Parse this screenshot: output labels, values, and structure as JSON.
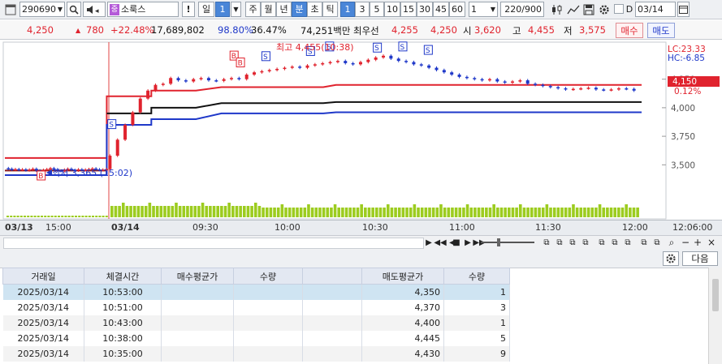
{
  "toolbar": {
    "code": "290690",
    "name": "소룩스",
    "period_day": "일",
    "period_num": "1",
    "periods": [
      "주",
      "월",
      "년",
      "분",
      "초",
      "틱"
    ],
    "intervals": [
      "1",
      "3",
      "5",
      "10",
      "15",
      "30",
      "45",
      "60"
    ],
    "count_select": "1",
    "count_display": "220/900",
    "date": "03/14",
    "d_label": "D",
    "excl": "!"
  },
  "quote": {
    "price": "4,250",
    "change": "780",
    "change_pct": "+22.48%",
    "volume": "17,689,802",
    "ratio1": "98.80%",
    "ratio2": "36.47%",
    "amount": "74,251백만",
    "best_ask_label": "최우선",
    "best_ask": "4,255",
    "best_bid": "4,250",
    "open_label": "시",
    "open": "3,620",
    "high_label": "고",
    "high": "4,455",
    "low_label": "저",
    "low": "3,575",
    "buy_button": "매수",
    "sell_button": "매도"
  },
  "chart_data": {
    "type": "candlestick",
    "yticks": [
      "4,250",
      "4,000",
      "3,750",
      "3,500"
    ],
    "ylim": [
      3275,
      4560
    ],
    "xticks": [
      "03/13",
      "15:00",
      "03/14",
      "09:30",
      "10:00",
      "10:30",
      "11:00",
      "11:30",
      "12:00",
      "12:06:00"
    ],
    "lc": "LC:23.33",
    "hc": "HC:-6.85",
    "current_price": "4,150",
    "current_pct": "0.12%",
    "high_annotation": "최고 4,455(10:38)",
    "low_annotation": "최저 3,365 (15:02)",
    "price_series": [
      3470,
      3465,
      3458,
      3462,
      3455,
      3460,
      3452,
      3458,
      3465,
      3450,
      3445,
      3455,
      3462,
      3470,
      3460,
      3450,
      3445,
      3458,
      3465,
      3455,
      3450,
      3460,
      3455,
      3458,
      3462,
      3468,
      3460,
      3455,
      3458,
      3462,
      3580,
      3720,
      3850,
      3960,
      4080,
      4150,
      4200,
      4210,
      4260,
      4240,
      4230,
      4250,
      4260,
      4240,
      4235,
      4250,
      4260,
      4250,
      4290,
      4310,
      4320,
      4330,
      4340,
      4350,
      4360,
      4350,
      4370,
      4380,
      4390,
      4400,
      4410,
      4390,
      4380,
      4400,
      4420,
      4440,
      4455,
      4430,
      4410,
      4400,
      4380,
      4370,
      4350,
      4330,
      4310,
      4290,
      4270,
      4260,
      4250,
      4240,
      4250,
      4230,
      4220,
      4230,
      4240,
      4210,
      4200,
      4190,
      4180,
      4170,
      4160,
      4165,
      4170,
      4175,
      4160,
      4155,
      4160,
      4170,
      4165,
      4150
    ],
    "bands": {
      "red": [
        [
          0,
          3560
        ],
        [
          0.07,
          3560
        ],
        [
          0.16,
          3560
        ],
        [
          0.16,
          4100
        ],
        [
          0.23,
          4100
        ],
        [
          0.23,
          4150
        ],
        [
          0.3,
          4150
        ],
        [
          0.34,
          4180
        ],
        [
          0.5,
          4180
        ],
        [
          0.52,
          4200
        ],
        [
          1,
          4200
        ]
      ],
      "black": [
        [
          0.16,
          3950
        ],
        [
          0.23,
          3950
        ],
        [
          0.23,
          4000
        ],
        [
          0.3,
          4000
        ],
        [
          0.34,
          4040
        ],
        [
          0.5,
          4040
        ],
        [
          0.52,
          4050
        ],
        [
          1,
          4050
        ]
      ],
      "blue": [
        [
          0,
          3410
        ],
        [
          0.16,
          3410
        ],
        [
          0.16,
          3850
        ],
        [
          0.23,
          3850
        ],
        [
          0.23,
          3900
        ],
        [
          0.3,
          3900
        ],
        [
          0.34,
          3950
        ],
        [
          0.5,
          3950
        ],
        [
          0.52,
          3960
        ],
        [
          1,
          3960
        ]
      ],
      "dark_red": [
        [
          0,
          3450
        ],
        [
          0.16,
          3450
        ]
      ]
    }
  },
  "navbar": {
    "icons": [
      "zoom-in",
      "zoom-out",
      "minus",
      "plus",
      "close"
    ]
  },
  "grid": {
    "next_button": "다음",
    "headers": [
      "거래일",
      "체결시간",
      "매수평균가",
      "수량",
      "",
      "매도평균가",
      "수량"
    ],
    "rows": [
      {
        "date": "2025/03/14",
        "time": "10:53:00",
        "buy_avg": "",
        "buy_qty": "",
        "sell_avg": "4,350",
        "sell_qty": "1"
      },
      {
        "date": "2025/03/14",
        "time": "10:51:00",
        "buy_avg": "",
        "buy_qty": "",
        "sell_avg": "4,370",
        "sell_qty": "3"
      },
      {
        "date": "2025/03/14",
        "time": "10:43:00",
        "buy_avg": "",
        "buy_qty": "",
        "sell_avg": "4,400",
        "sell_qty": "1"
      },
      {
        "date": "2025/03/14",
        "time": "10:38:00",
        "buy_avg": "",
        "buy_qty": "",
        "sell_avg": "4,445",
        "sell_qty": "5"
      },
      {
        "date": "2025/03/14",
        "time": "10:35:00",
        "buy_avg": "",
        "buy_qty": "",
        "sell_avg": "4,430",
        "sell_qty": "9"
      }
    ]
  }
}
